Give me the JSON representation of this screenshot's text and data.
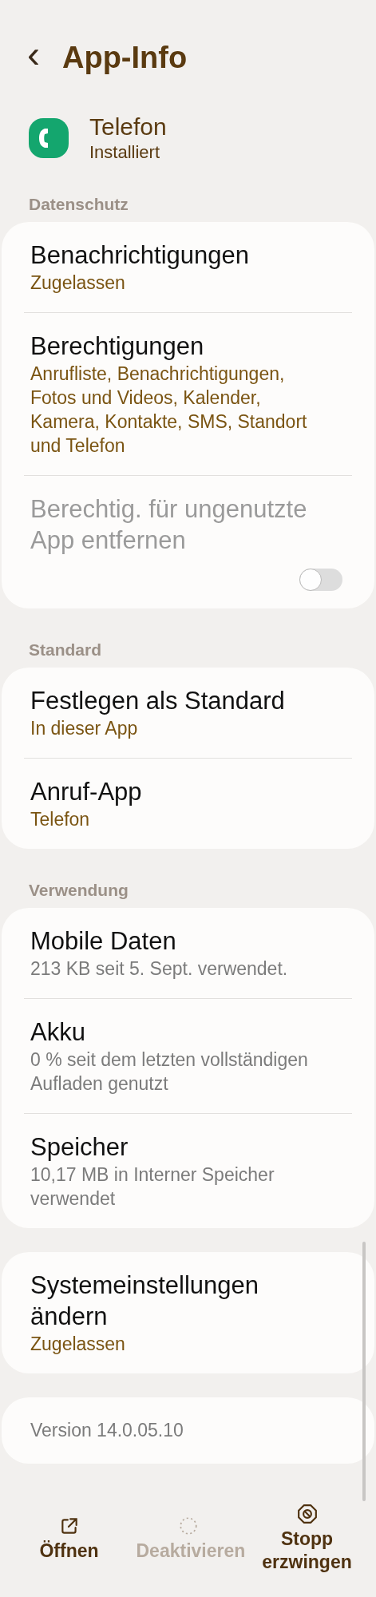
{
  "header": {
    "back": "‹",
    "title": "App-Info"
  },
  "app": {
    "name": "Telefon",
    "status": "Installiert"
  },
  "sections": [
    {
      "header": "Datenschutz",
      "items": [
        {
          "kind": "value",
          "title": "Benachrichtigungen",
          "subtitle": "Zugelassen",
          "disabled": false
        },
        {
          "kind": "value",
          "title": "Berechtigungen",
          "subtitle": "Anrufliste, Benachrichtigungen, Fotos und Videos, Kalender, Kamera, Kontakte, SMS, Standort und Telefon",
          "disabled": false
        },
        {
          "kind": "toggle",
          "title": "Berechtig. für ungenutzte App entfernen",
          "on": false,
          "disabled": true
        }
      ]
    },
    {
      "header": "Standard",
      "items": [
        {
          "kind": "value",
          "title": "Festlegen als Standard",
          "subtitle": "In dieser App",
          "disabled": false
        },
        {
          "kind": "value",
          "title": "Anruf-App",
          "subtitle": "Telefon",
          "disabled": false
        }
      ]
    },
    {
      "header": "Verwendung",
      "items": [
        {
          "kind": "info",
          "title": "Mobile Daten",
          "subtitle": "213 KB seit 5. Sept. verwendet.",
          "disabled": false
        },
        {
          "kind": "info",
          "title": "Akku",
          "subtitle": "0 % seit dem letzten vollständigen Aufladen genutzt",
          "disabled": false
        },
        {
          "kind": "info",
          "title": "Speicher",
          "subtitle": "10,17 MB in Interner Speicher verwendet",
          "disabled": false
        }
      ]
    },
    {
      "items": [
        {
          "kind": "value",
          "title": "Systemeinstellungen ändern",
          "subtitle": "Zugelassen",
          "disabled": false
        }
      ]
    }
  ],
  "version": "Version 14.0.05.10",
  "actions": [
    {
      "kind": "open",
      "label": "Öffnen",
      "disabled": false
    },
    {
      "kind": "deactivate",
      "label": "Deaktivieren",
      "disabled": true
    },
    {
      "kind": "stop",
      "label": "Stopp erzwingen",
      "disabled": false
    }
  ]
}
